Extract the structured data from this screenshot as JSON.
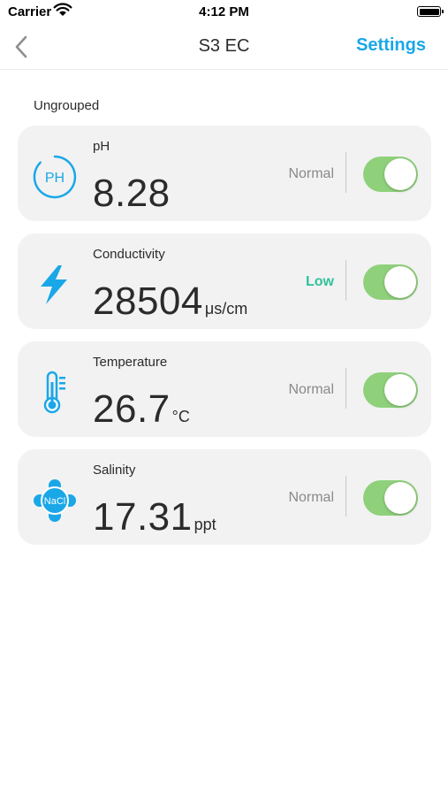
{
  "status_bar": {
    "carrier": "Carrier",
    "time": "4:12 PM"
  },
  "nav": {
    "title": "S3 EC",
    "settings_label": "Settings"
  },
  "group_label": "Ungrouped",
  "icons": {
    "ph": "ph-icon",
    "conductivity": "lightning-icon",
    "temperature": "thermometer-icon",
    "salinity": "nacl-icon",
    "back": "chevron-left-icon"
  },
  "colors": {
    "accent": "#1aa7e8",
    "toggle_on": "#8fd17b",
    "status_low": "#2fc29a",
    "status_normal": "#8a8a8a",
    "card_bg": "#f2f2f2"
  },
  "sensors": [
    {
      "name": "pH",
      "icon_text": "PH",
      "value": "8.28",
      "unit": "",
      "status": "Normal",
      "enabled": true
    },
    {
      "name": "Conductivity",
      "value": "28504",
      "unit": "μs/cm",
      "status": "Low",
      "enabled": true
    },
    {
      "name": "Temperature",
      "value": "26.7",
      "unit": "°C",
      "status": "Normal",
      "enabled": true
    },
    {
      "name": "Salinity",
      "icon_text": "NaCl",
      "value": "17.31",
      "unit": "ppt",
      "status": "Normal",
      "enabled": true
    }
  ]
}
